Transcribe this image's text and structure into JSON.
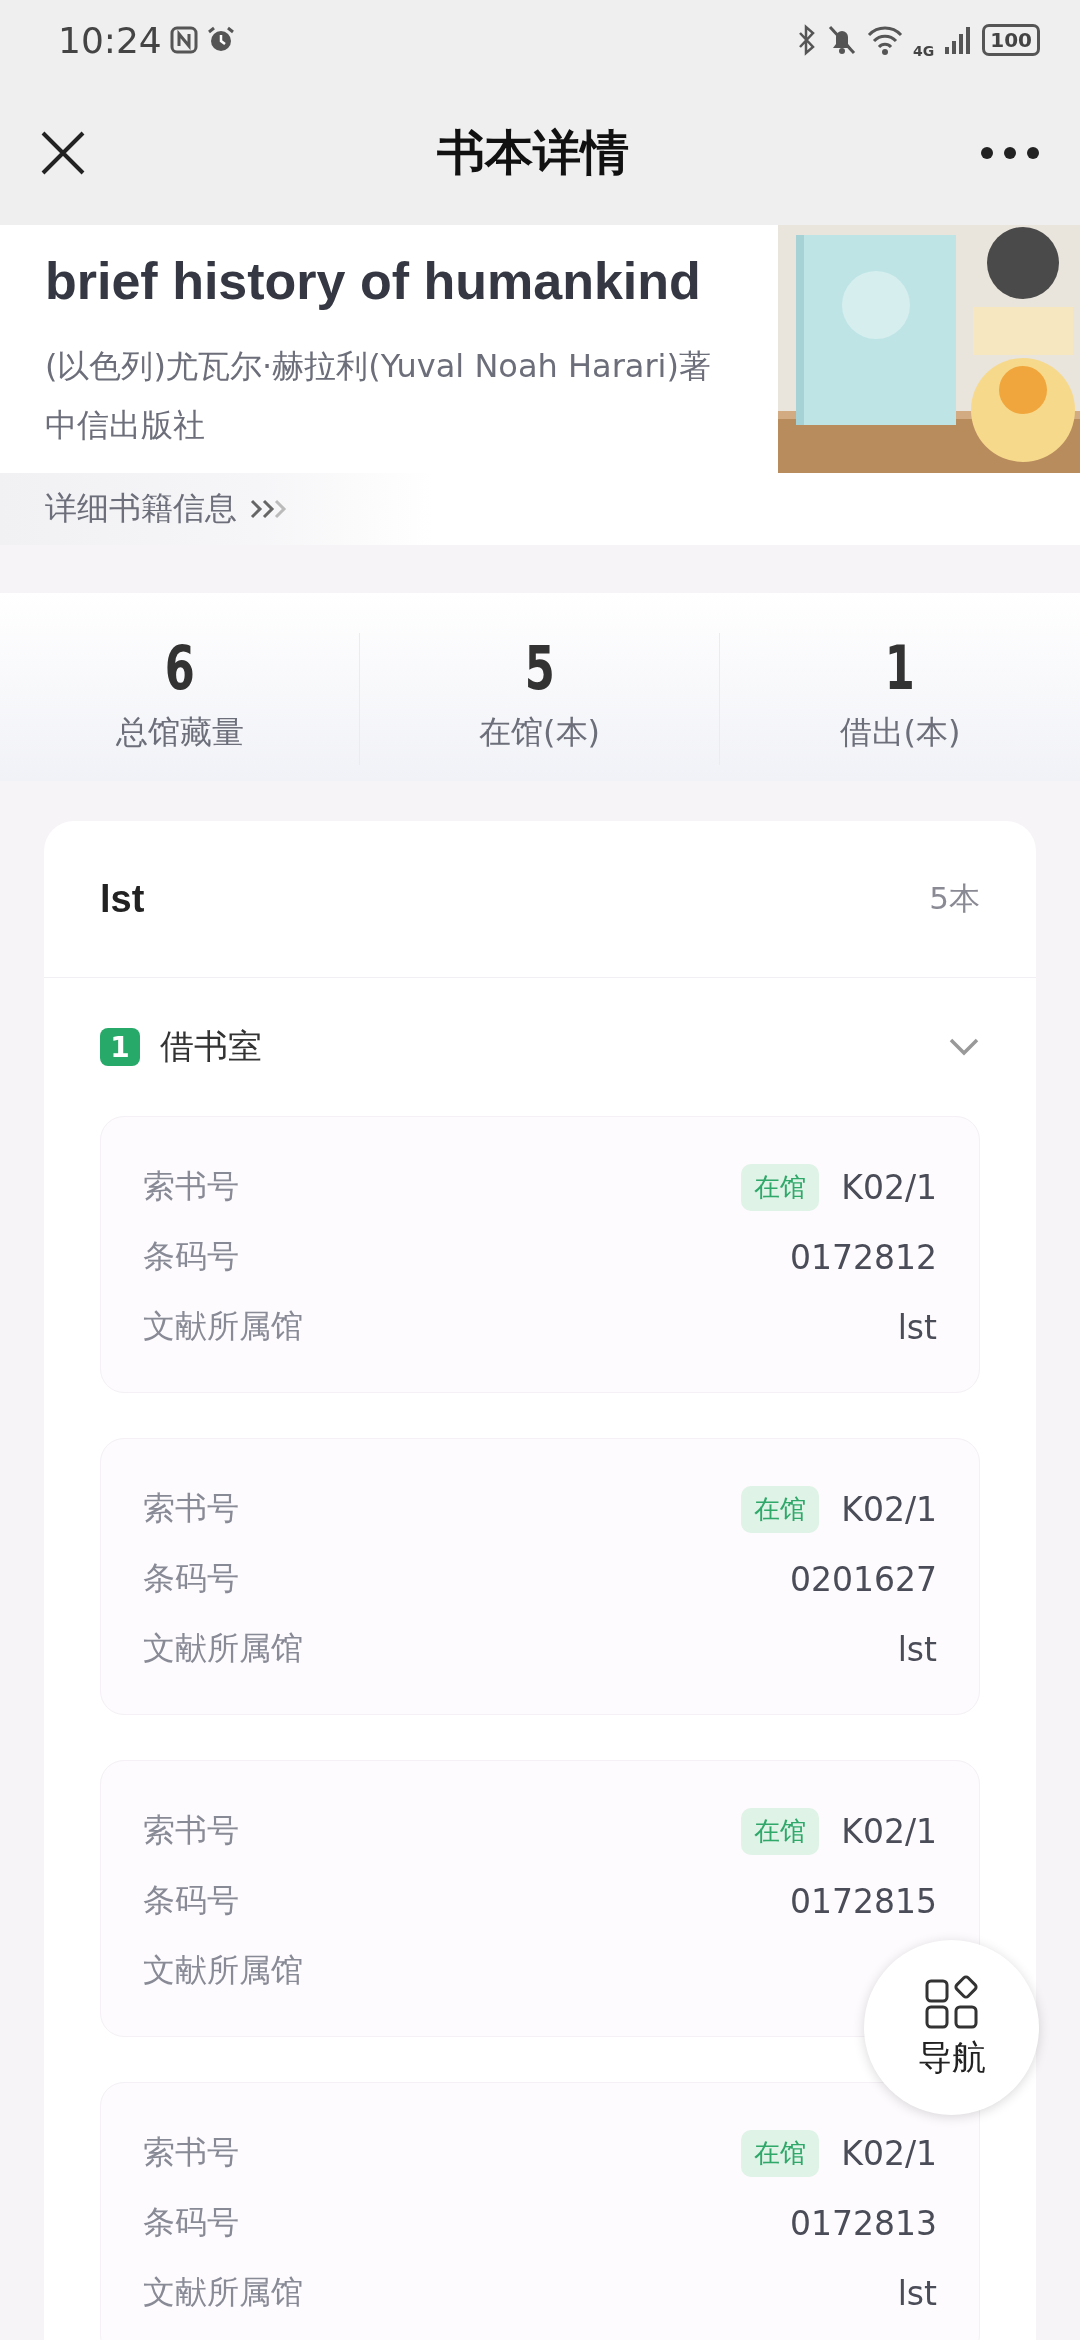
{
  "status_bar": {
    "time": "10:24",
    "battery": "100",
    "network": "4G"
  },
  "header": {
    "title": "书本详情"
  },
  "book": {
    "title": "brief history of humankind",
    "author": "(以色列)尤瓦尔·赫拉利(Yuval Noah Harari)著",
    "publisher": "中信出版社",
    "details_link": "详细书籍信息"
  },
  "stats": [
    {
      "value": "6",
      "label": "总馆藏量"
    },
    {
      "value": "5",
      "label": "在馆(本)"
    },
    {
      "value": "1",
      "label": "借出(本)"
    }
  ],
  "library": {
    "name": "lst",
    "count": "5本",
    "groups": [
      {
        "index": "1",
        "name": "借书室",
        "expanded": true,
        "copies": [
          {
            "call_label": "索书号",
            "status": "在馆",
            "call_number": "K02/1",
            "barcode_label": "条码号",
            "barcode": "0172812",
            "branch_label": "文献所属馆",
            "branch": "lst"
          },
          {
            "call_label": "索书号",
            "status": "在馆",
            "call_number": "K02/1",
            "barcode_label": "条码号",
            "barcode": "0201627",
            "branch_label": "文献所属馆",
            "branch": "lst"
          },
          {
            "call_label": "索书号",
            "status": "在馆",
            "call_number": "K02/1",
            "barcode_label": "条码号",
            "barcode": "0172815",
            "branch_label": "文献所属馆"
          },
          {
            "call_label": "索书号",
            "status": "在馆",
            "call_number": "K02/1",
            "barcode_label": "条码号",
            "barcode": "0172813",
            "branch_label": "文献所属馆",
            "branch": "lst"
          }
        ]
      }
    ]
  },
  "nav_button": {
    "label": "导航"
  }
}
